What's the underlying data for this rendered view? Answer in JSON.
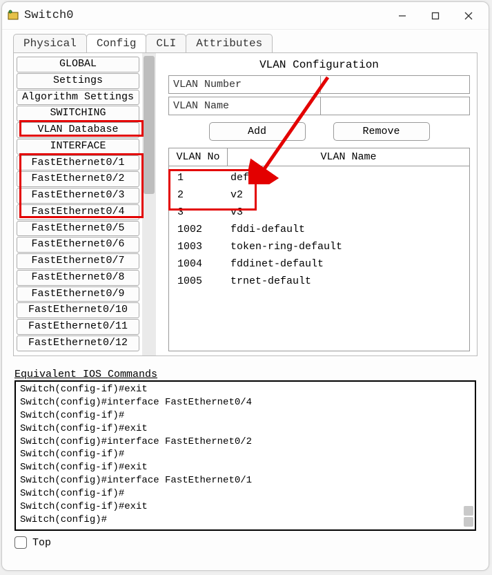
{
  "window": {
    "title": "Switch0"
  },
  "tabs": [
    "Physical",
    "Config",
    "CLI",
    "Attributes"
  ],
  "active_tab": "Config",
  "sidebar": {
    "sections": [
      {
        "label": "GLOBAL",
        "type": "header"
      },
      {
        "label": "Settings",
        "type": "item"
      },
      {
        "label": "Algorithm Settings",
        "type": "item"
      },
      {
        "label": "SWITCHING",
        "type": "header"
      },
      {
        "label": "VLAN Database",
        "type": "item"
      },
      {
        "label": "INTERFACE",
        "type": "header"
      },
      {
        "label": "FastEthernet0/1",
        "type": "item"
      },
      {
        "label": "FastEthernet0/2",
        "type": "item"
      },
      {
        "label": "FastEthernet0/3",
        "type": "item"
      },
      {
        "label": "FastEthernet0/4",
        "type": "item"
      },
      {
        "label": "FastEthernet0/5",
        "type": "item"
      },
      {
        "label": "FastEthernet0/6",
        "type": "item"
      },
      {
        "label": "FastEthernet0/7",
        "type": "item"
      },
      {
        "label": "FastEthernet0/8",
        "type": "item"
      },
      {
        "label": "FastEthernet0/9",
        "type": "item"
      },
      {
        "label": "FastEthernet0/10",
        "type": "item"
      },
      {
        "label": "FastEthernet0/11",
        "type": "item"
      },
      {
        "label": "FastEthernet0/12",
        "type": "item"
      }
    ]
  },
  "vlan_config": {
    "title": "VLAN Configuration",
    "number_label": "VLAN Number",
    "name_label": "VLAN Name",
    "number_value": "",
    "name_value": "",
    "add_btn": "Add",
    "remove_btn": "Remove",
    "table": {
      "headers": {
        "no": "VLAN No",
        "name": "VLAN Name"
      },
      "rows": [
        {
          "no": "1",
          "name": "default"
        },
        {
          "no": "2",
          "name": "v2"
        },
        {
          "no": "3",
          "name": "v3"
        },
        {
          "no": "1002",
          "name": "fddi-default"
        },
        {
          "no": "1003",
          "name": "token-ring-default"
        },
        {
          "no": "1004",
          "name": "fddinet-default"
        },
        {
          "no": "1005",
          "name": "trnet-default"
        }
      ]
    }
  },
  "ios": {
    "label": "Equivalent IOS Commands",
    "lines": [
      "Switch(config-if)#exit",
      "Switch(config)#interface FastEthernet0/4",
      "Switch(config-if)#",
      "Switch(config-if)#exit",
      "Switch(config)#interface FastEthernet0/2",
      "Switch(config-if)#",
      "Switch(config-if)#exit",
      "Switch(config)#interface FastEthernet0/1",
      "Switch(config-if)#",
      "Switch(config-if)#exit",
      "Switch(config)#"
    ]
  },
  "bottom": {
    "top_label": "Top"
  }
}
